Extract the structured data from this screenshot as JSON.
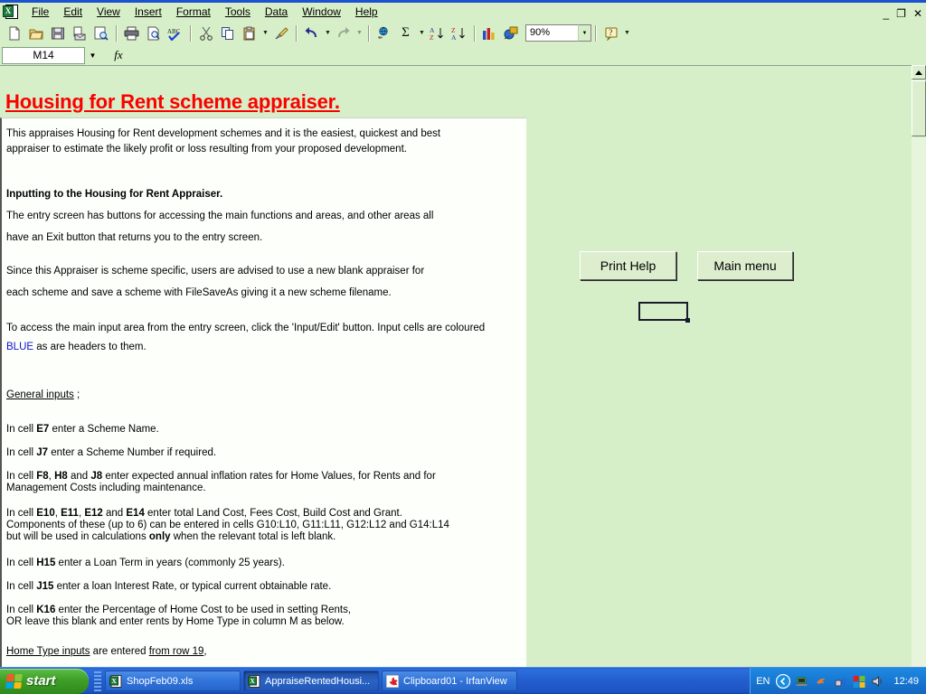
{
  "window": {
    "app_icon": "excel-icon",
    "minimize_label": "_",
    "restore_label": "❐",
    "close_label": "✕"
  },
  "menu": {
    "items": [
      {
        "label": "File",
        "accel": "F"
      },
      {
        "label": "Edit",
        "accel": "E"
      },
      {
        "label": "View",
        "accel": "V"
      },
      {
        "label": "Insert",
        "accel": "I"
      },
      {
        "label": "Format",
        "accel": "o"
      },
      {
        "label": "Tools",
        "accel": "T"
      },
      {
        "label": "Data",
        "accel": "D"
      },
      {
        "label": "Window",
        "accel": "W"
      },
      {
        "label": "Help",
        "accel": "H"
      }
    ]
  },
  "toolbar": {
    "buttons": [
      {
        "name": "new-icon",
        "title": "New"
      },
      {
        "name": "open-icon",
        "title": "Open"
      },
      {
        "name": "save-icon",
        "title": "Save"
      },
      {
        "name": "mail-recipient-icon",
        "title": "E-mail"
      },
      {
        "name": "search-icon",
        "title": "Search"
      },
      {
        "name": "print-icon",
        "title": "Print"
      },
      {
        "name": "print-preview-icon",
        "title": "Print Preview"
      },
      {
        "name": "spelling-icon",
        "title": "Spelling"
      },
      {
        "name": "cut-icon",
        "title": "Cut"
      },
      {
        "name": "copy-icon",
        "title": "Copy"
      },
      {
        "name": "paste-icon",
        "title": "Paste"
      },
      {
        "name": "format-painter-icon",
        "title": "Format Painter"
      },
      {
        "name": "undo-icon",
        "title": "Undo"
      },
      {
        "name": "redo-icon",
        "title": "Redo"
      },
      {
        "name": "hyperlink-icon",
        "title": "Insert Hyperlink"
      },
      {
        "name": "autosum-icon",
        "title": "AutoSum"
      },
      {
        "name": "sort-ascending-icon",
        "title": "Sort Ascending"
      },
      {
        "name": "sort-descending-icon",
        "title": "Sort Descending"
      },
      {
        "name": "chart-wizard-icon",
        "title": "Chart Wizard"
      },
      {
        "name": "drawing-icon",
        "title": "Drawing"
      }
    ],
    "zoom_value": "90%",
    "help_icon": "help-icon"
  },
  "formula_bar": {
    "name_box_value": "M14",
    "fx_label": "fx",
    "formula_value": ""
  },
  "sheet": {
    "doc_title": "Housing for Rent scheme appraiser.",
    "paragraphs": [
      {
        "id": "p1a",
        "text": "This appraises Housing for Rent development schemes and it is the easiest, quickest and best"
      },
      {
        "id": "p1b",
        "text": "appraiser to estimate the likely profit or loss resulting from your proposed development."
      },
      {
        "id": "h1",
        "text": "Inputting to the Housing for Rent Appraiser."
      },
      {
        "id": "p2a",
        "text": "The entry screen has buttons for accessing the main functions and areas, and other areas all"
      },
      {
        "id": "p2b",
        "text": "have an Exit button that returns you to the entry screen."
      },
      {
        "id": "p3a",
        "text": "Since this Appraiser is scheme specific, users are advised to use a new blank appraiser for"
      },
      {
        "id": "p3b",
        "text": "each scheme and save a scheme with FileSaveAs giving it a new scheme filename."
      },
      {
        "id": "p4a",
        "text": "To access the main input area from the entry screen, click the 'Input/Edit' button. Input cells are coloured"
      },
      {
        "id": "p4b_blue",
        "text": "BLUE"
      },
      {
        "id": "p4b_rest",
        "text": " as are headers to them."
      },
      {
        "id": "h2",
        "text": "General inputs"
      },
      {
        "id": "h2_semi",
        "text": " ;"
      },
      {
        "id": "p5",
        "text": "In cell E7 enter a Scheme Name."
      },
      {
        "id": "p6",
        "text": "In cell J7 enter a Scheme Number if required."
      },
      {
        "id": "p7a",
        "text": "In cell F8, H8 and J8 enter expected annual inflation rates for Home Values, for Rents and for"
      },
      {
        "id": "p7b",
        "text": "Management Costs including maintenance."
      },
      {
        "id": "p8a",
        "text": "In cell E10, E11, E12 and E14 enter total Land Cost, Fees Cost, Build Cost and Grant."
      },
      {
        "id": "p8b",
        "text": "Components of these (up to 6) can be entered in cells G10:L10, G11:L11, G12:L12 and G14:L14"
      },
      {
        "id": "p8c",
        "text": "but will be used in calculations only when the relevant total is left blank."
      },
      {
        "id": "p9",
        "text": "In cell H15 enter a Loan Term in years (commonly 25 years)."
      },
      {
        "id": "p10",
        "text": "In cell J15 enter a loan Interest Rate, or typical current obtainable rate."
      },
      {
        "id": "p11a",
        "text": "In cell K16 enter the Percentage of Home Cost to be used in setting Rents,"
      },
      {
        "id": "p11b",
        "text": "OR leave this blank and enter rents by Home Type in column M as below."
      },
      {
        "id": "p12a",
        "text": "Home Type inputs"
      },
      {
        "id": "p12b",
        "text": " are entered "
      },
      {
        "id": "p12c",
        "text": "from row 19"
      },
      {
        "id": "p12d",
        "text": ","
      }
    ],
    "buttons": [
      {
        "id": "print-help",
        "label": "Print Help"
      },
      {
        "id": "main-menu",
        "label": "Main menu"
      }
    ],
    "selected_cell": "M14",
    "colors": {
      "title_red": "#fa0000",
      "blue_text": "#1111cc",
      "sheet_background": "#d7efc8",
      "panel_background": "#fdfffb"
    }
  },
  "scrollbar": {
    "up_arrow": "scroll-up-icon",
    "down_arrow": "scroll-down-icon"
  },
  "taskbar": {
    "start_label": "start",
    "items": [
      {
        "label": "ShopFeb09.xls",
        "icon": "excel-icon",
        "active": false
      },
      {
        "label": "AppraiseRentedHousi...",
        "icon": "excel-icon",
        "active": true
      },
      {
        "label": "Clipboard01 - IrfanView",
        "icon": "irfanview-icon",
        "active": false
      }
    ],
    "tray": {
      "language": "EN",
      "icons": [
        "messenger-icon",
        "network-icon",
        "irfanview-tray-icon",
        "wireless-icon",
        "windows-update-icon",
        "volume-icon"
      ],
      "clock": "12:49"
    }
  }
}
